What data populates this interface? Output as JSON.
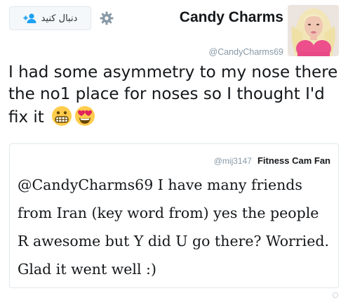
{
  "header": {
    "follow_label": "دنبال کنید",
    "name": "Candy Charms",
    "handle": "@CandyCharms69"
  },
  "tweet": {
    "text": "I had some asymmetry to my nose there the no1 place for noses so I thought I'd fix it",
    "emojis": [
      "grimacing-face-emoji",
      "heart-eyes-emoji"
    ]
  },
  "quoted": {
    "display_name": "Fitness Cam Fan",
    "handle": "@mij3147",
    "text": "@CandyCharms69  I have many friends from Iran (key word from) yes the people R awesome but Y did U go there? Worried.  Glad it went well :)"
  },
  "colors": {
    "follow_icon": "#1da1f2",
    "muted": "#8899a6",
    "border": "#e1e8ed"
  }
}
